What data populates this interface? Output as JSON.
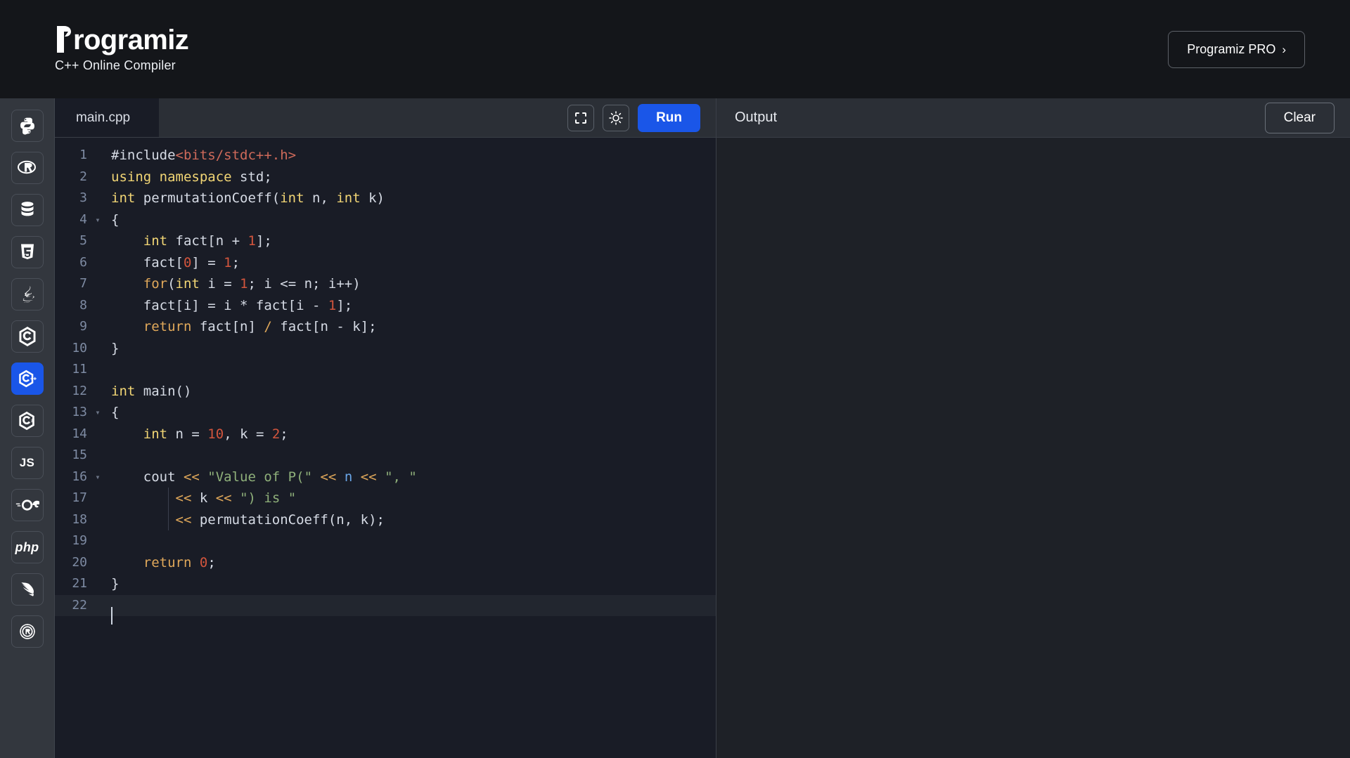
{
  "header": {
    "logo_text": "rogramiz",
    "logo_icon": "programiz-p-logo",
    "tagline": "C++ Online Compiler",
    "pro_button_label": "Programiz PRO",
    "pro_button_chevron": "›"
  },
  "sidebar": {
    "items": [
      {
        "name": "python",
        "glyph": "python-icon",
        "label": "",
        "active": false
      },
      {
        "name": "r",
        "glyph": "r-icon",
        "label": "",
        "active": false
      },
      {
        "name": "sql",
        "glyph": "database-icon",
        "label": "",
        "active": false
      },
      {
        "name": "html",
        "glyph": "html5-icon",
        "label": "",
        "active": false
      },
      {
        "name": "java",
        "glyph": "java-icon",
        "label": "",
        "active": false
      },
      {
        "name": "c",
        "glyph": "c-icon",
        "label": "",
        "active": false
      },
      {
        "name": "cpp",
        "glyph": "cpp-icon",
        "label": "",
        "active": true
      },
      {
        "name": "csharp",
        "glyph": "csharp-icon",
        "label": "",
        "active": false
      },
      {
        "name": "javascript",
        "glyph": "js-text",
        "label": "JS",
        "active": false
      },
      {
        "name": "go",
        "glyph": "go-icon",
        "label": "GO",
        "active": false
      },
      {
        "name": "php",
        "glyph": "php-text",
        "label": "php",
        "active": false
      },
      {
        "name": "swift",
        "glyph": "swift-icon",
        "label": "",
        "active": false
      },
      {
        "name": "rust",
        "glyph": "rust-icon",
        "label": "",
        "active": false
      }
    ]
  },
  "editor": {
    "tab_label": "main.cpp",
    "fullscreen_icon": "fullscreen-icon",
    "theme_icon": "sun-icon",
    "run_label": "Run",
    "lines": [
      {
        "n": "1",
        "fold": "",
        "active": false,
        "tokens": [
          {
            "t": "#include",
            "c": "t-inc"
          },
          {
            "t": "<bits/stdc++.h>",
            "c": "t-incpath"
          }
        ]
      },
      {
        "n": "2",
        "fold": "",
        "active": false,
        "tokens": [
          {
            "t": "using",
            "c": "t-key"
          },
          {
            "t": " ",
            "c": "t-punc"
          },
          {
            "t": "namespace",
            "c": "t-key"
          },
          {
            "t": " std;",
            "c": "t-ident"
          }
        ]
      },
      {
        "n": "3",
        "fold": "",
        "active": false,
        "tokens": [
          {
            "t": "int",
            "c": "t-key"
          },
          {
            "t": " permutationCoeff(",
            "c": "t-ident"
          },
          {
            "t": "int",
            "c": "t-key"
          },
          {
            "t": " n, ",
            "c": "t-ident"
          },
          {
            "t": "int",
            "c": "t-key"
          },
          {
            "t": " k)",
            "c": "t-ident"
          }
        ]
      },
      {
        "n": "4",
        "fold": "▾",
        "active": false,
        "tokens": [
          {
            "t": "{",
            "c": "t-punc"
          }
        ]
      },
      {
        "n": "5",
        "fold": "",
        "active": false,
        "tokens": [
          {
            "t": "    ",
            "c": "t-punc"
          },
          {
            "t": "int",
            "c": "t-key"
          },
          {
            "t": " fact[n ",
            "c": "t-ident"
          },
          {
            "t": "+",
            "c": "t-op"
          },
          {
            "t": " ",
            "c": "t-punc"
          },
          {
            "t": "1",
            "c": "t-num"
          },
          {
            "t": "];",
            "c": "t-ident"
          }
        ]
      },
      {
        "n": "6",
        "fold": "",
        "active": false,
        "tokens": [
          {
            "t": "    fact[",
            "c": "t-ident"
          },
          {
            "t": "0",
            "c": "t-num"
          },
          {
            "t": "] = ",
            "c": "t-ident"
          },
          {
            "t": "1",
            "c": "t-num"
          },
          {
            "t": ";",
            "c": "t-ident"
          }
        ]
      },
      {
        "n": "7",
        "fold": "",
        "active": false,
        "tokens": [
          {
            "t": "    ",
            "c": "t-punc"
          },
          {
            "t": "for",
            "c": "t-kw2"
          },
          {
            "t": "(",
            "c": "t-ident"
          },
          {
            "t": "int",
            "c": "t-key"
          },
          {
            "t": " i = ",
            "c": "t-ident"
          },
          {
            "t": "1",
            "c": "t-num"
          },
          {
            "t": "; i <= n; i++)",
            "c": "t-ident"
          }
        ]
      },
      {
        "n": "8",
        "fold": "",
        "active": false,
        "tokens": [
          {
            "t": "    fact[i] = i ",
            "c": "t-ident"
          },
          {
            "t": "*",
            "c": "t-op"
          },
          {
            "t": " fact[i ",
            "c": "t-ident"
          },
          {
            "t": "-",
            "c": "t-op"
          },
          {
            "t": " ",
            "c": "t-punc"
          },
          {
            "t": "1",
            "c": "t-num"
          },
          {
            "t": "];",
            "c": "t-ident"
          }
        ]
      },
      {
        "n": "9",
        "fold": "",
        "active": false,
        "tokens": [
          {
            "t": "    ",
            "c": "t-punc"
          },
          {
            "t": "return",
            "c": "t-kw2"
          },
          {
            "t": " fact[n] ",
            "c": "t-ident"
          },
          {
            "t": "/",
            "c": "t-shift"
          },
          {
            "t": " fact[n ",
            "c": "t-ident"
          },
          {
            "t": "-",
            "c": "t-op"
          },
          {
            "t": " k];",
            "c": "t-ident"
          }
        ]
      },
      {
        "n": "10",
        "fold": "",
        "active": false,
        "tokens": [
          {
            "t": "}",
            "c": "t-punc"
          }
        ]
      },
      {
        "n": "11",
        "fold": "",
        "active": false,
        "tokens": []
      },
      {
        "n": "12",
        "fold": "",
        "active": false,
        "tokens": [
          {
            "t": "int",
            "c": "t-key"
          },
          {
            "t": " main()",
            "c": "t-ident"
          }
        ]
      },
      {
        "n": "13",
        "fold": "▾",
        "active": false,
        "tokens": [
          {
            "t": "{",
            "c": "t-punc"
          }
        ]
      },
      {
        "n": "14",
        "fold": "",
        "active": false,
        "tokens": [
          {
            "t": "    ",
            "c": "t-punc"
          },
          {
            "t": "int",
            "c": "t-key"
          },
          {
            "t": " n = ",
            "c": "t-ident"
          },
          {
            "t": "10",
            "c": "t-num"
          },
          {
            "t": ", k = ",
            "c": "t-ident"
          },
          {
            "t": "2",
            "c": "t-num"
          },
          {
            "t": ";",
            "c": "t-ident"
          }
        ]
      },
      {
        "n": "15",
        "fold": "",
        "active": false,
        "tokens": []
      },
      {
        "n": "16",
        "fold": "▾",
        "active": false,
        "tokens": [
          {
            "t": "    cout ",
            "c": "t-ident"
          },
          {
            "t": "<<",
            "c": "t-shift"
          },
          {
            "t": " ",
            "c": "t-punc"
          },
          {
            "t": "\"Value of P(\"",
            "c": "t-str"
          },
          {
            "t": " ",
            "c": "t-punc"
          },
          {
            "t": "<<",
            "c": "t-shift"
          },
          {
            "t": " ",
            "c": "t-punc"
          },
          {
            "t": "n",
            "c": "t-var"
          },
          {
            "t": " ",
            "c": "t-punc"
          },
          {
            "t": "<<",
            "c": "t-shift"
          },
          {
            "t": " ",
            "c": "t-punc"
          },
          {
            "t": "\", \"",
            "c": "t-str"
          }
        ]
      },
      {
        "n": "17",
        "fold": "",
        "active": false,
        "tokens": [
          {
            "t": "        ",
            "c": "t-punc"
          },
          {
            "t": "<<",
            "c": "t-shift"
          },
          {
            "t": " k ",
            "c": "t-ident"
          },
          {
            "t": "<<",
            "c": "t-shift"
          },
          {
            "t": " ",
            "c": "t-punc"
          },
          {
            "t": "\") is \"",
            "c": "t-str"
          }
        ]
      },
      {
        "n": "18",
        "fold": "",
        "active": false,
        "tokens": [
          {
            "t": "        ",
            "c": "t-punc"
          },
          {
            "t": "<<",
            "c": "t-shift"
          },
          {
            "t": " permutationCoeff(n, k);",
            "c": "t-ident"
          }
        ]
      },
      {
        "n": "19",
        "fold": "",
        "active": false,
        "tokens": []
      },
      {
        "n": "20",
        "fold": "",
        "active": false,
        "tokens": [
          {
            "t": "    ",
            "c": "t-punc"
          },
          {
            "t": "return",
            "c": "t-kw2"
          },
          {
            "t": " ",
            "c": "t-punc"
          },
          {
            "t": "0",
            "c": "t-num"
          },
          {
            "t": ";",
            "c": "t-ident"
          }
        ]
      },
      {
        "n": "21",
        "fold": "",
        "active": false,
        "tokens": [
          {
            "t": "}",
            "c": "t-punc"
          }
        ]
      },
      {
        "n": "22",
        "fold": "",
        "active": true,
        "tokens": []
      }
    ]
  },
  "output": {
    "title": "Output",
    "clear_label": "Clear",
    "body": ""
  },
  "colors": {
    "accent_blue": "#1a56e8",
    "topbar_bg": "#14161a",
    "sidebar_bg": "#33373e",
    "editor_bg": "#191c26",
    "panel_bg": "#2b2f36",
    "output_bg": "#1e2127"
  }
}
